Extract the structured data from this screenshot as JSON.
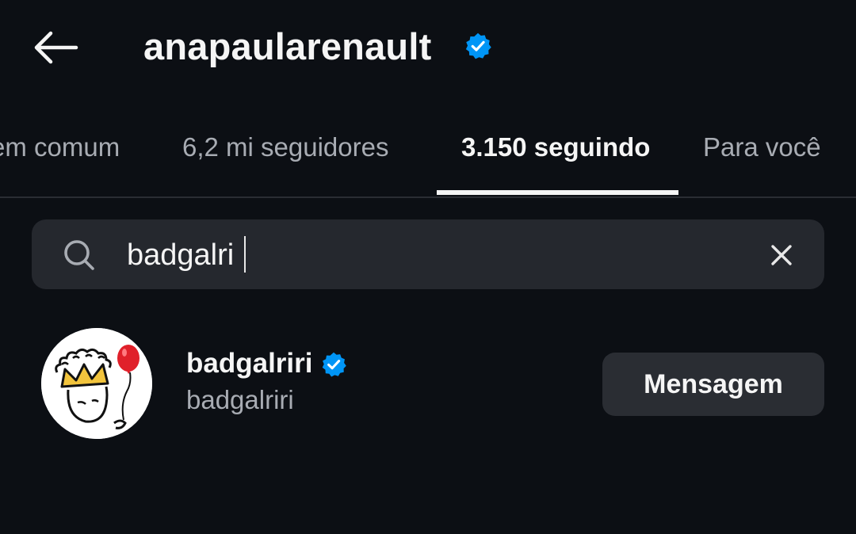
{
  "header": {
    "username": "anapaularenault",
    "verified": true,
    "back_icon": "arrow-left-icon",
    "verified_icon": "verified-badge-icon"
  },
  "tabs": [
    {
      "label": "em comum",
      "active": false
    },
    {
      "label": "6,2 mi seguidores",
      "active": false
    },
    {
      "label": "3.150 seguindo",
      "active": true
    },
    {
      "label": "Para você",
      "active": false
    }
  ],
  "search": {
    "value": "badgalri",
    "search_icon": "search-icon",
    "clear_icon": "close-icon"
  },
  "results": [
    {
      "name": "badgalriri",
      "handle": "badgalriri",
      "verified": true,
      "action_label": "Mensagem"
    }
  ],
  "colors": {
    "background": "#0c0f14",
    "surface": "#25282e",
    "button": "#2a2d33",
    "text_primary": "#f5f5f5",
    "text_secondary": "#a8acb3",
    "verified_blue": "#0095f6"
  }
}
